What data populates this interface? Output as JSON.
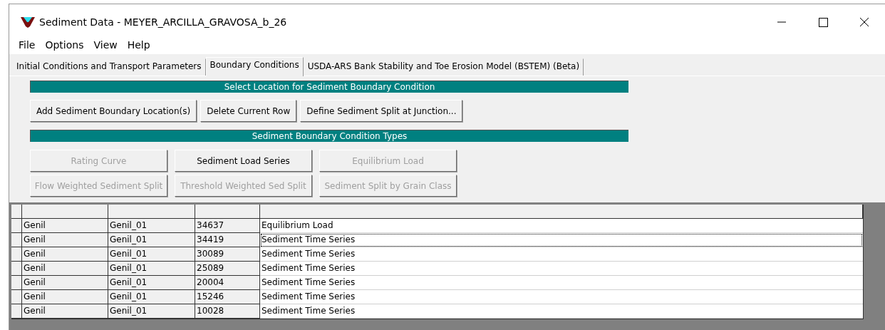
{
  "window": {
    "title": "Sediment Data - MEYER_ARCILLA_GRAVOSA_b_26"
  },
  "menu": [
    "File",
    "Options",
    "View",
    "Help"
  ],
  "tabs": [
    {
      "label": "Initial Conditions and Transport Parameters",
      "selected": false
    },
    {
      "label": "Boundary Conditions",
      "selected": true
    },
    {
      "label": "USDA-ARS Bank Stability and Toe Erosion Model (BSTEM) (Beta)",
      "selected": false
    }
  ],
  "location_header": "Select Location for Sediment Boundary Condition",
  "location_buttons": [
    "Add Sediment Boundary Location(s)",
    "Delete Current Row",
    "Define Sediment Split at Junction..."
  ],
  "types_header": "Sediment Boundary Condition Types",
  "type_buttons": [
    {
      "label": "Rating Curve",
      "disabled": true
    },
    {
      "label": "Sediment Load Series",
      "disabled": false
    },
    {
      "label": "Equilibrium Load",
      "disabled": true
    },
    {
      "label": "Flow Weighted Sediment Split",
      "disabled": true
    },
    {
      "label": "Threshold Weighted Sed Split",
      "disabled": true
    },
    {
      "label": "Sediment Split by Grain Class",
      "disabled": true
    }
  ],
  "table": {
    "rows": [
      {
        "cells": [
          "Genil",
          "Genil_01",
          "34637",
          "Equilibrium Load"
        ],
        "focused": false
      },
      {
        "cells": [
          "Genil",
          "Genil_01",
          "34419",
          "Sediment Time Series"
        ],
        "focused": true
      },
      {
        "cells": [
          "Genil",
          "Genil_01",
          "30089",
          "Sediment Time Series"
        ],
        "focused": false
      },
      {
        "cells": [
          "Genil",
          "Genil_01",
          "25089",
          "Sediment Time Series"
        ],
        "focused": false
      },
      {
        "cells": [
          "Genil",
          "Genil_01",
          "20004",
          "Sediment Time Series"
        ],
        "focused": false
      },
      {
        "cells": [
          "Genil",
          "Genil_01",
          "15246",
          "Sediment Time Series"
        ],
        "focused": false
      },
      {
        "cells": [
          "Genil",
          "Genil_01",
          "10028",
          "Sediment Time Series"
        ],
        "focused": false
      }
    ]
  }
}
